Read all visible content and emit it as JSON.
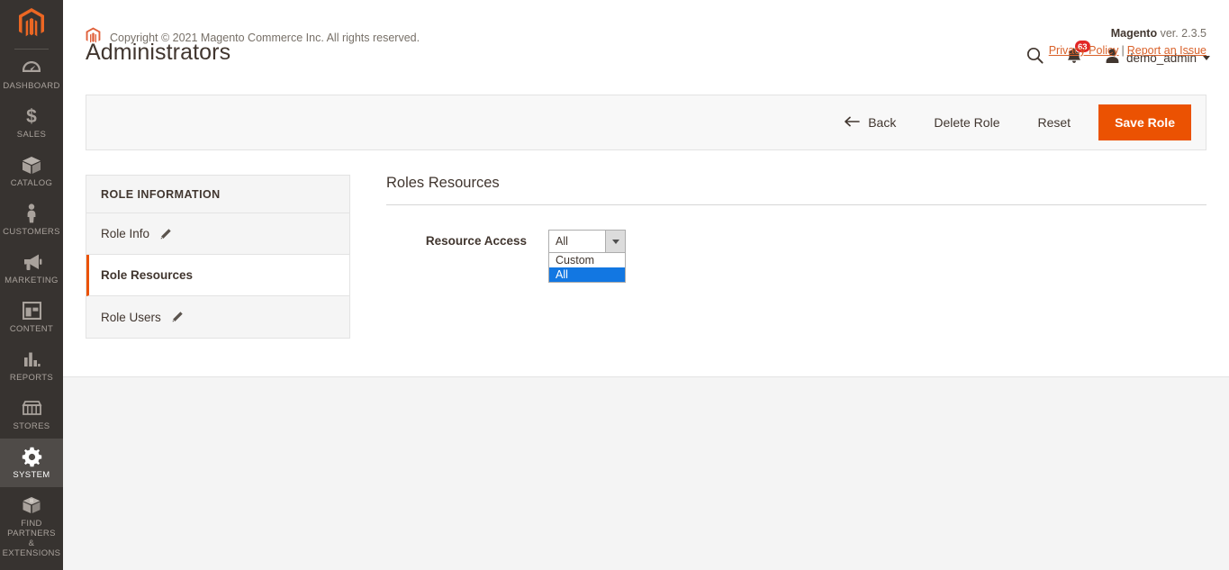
{
  "sidebar": {
    "logo_icon": "magento-logo-icon",
    "items": [
      {
        "label": "DASHBOARD",
        "icon": "dashboard-icon",
        "active": false
      },
      {
        "label": "SALES",
        "icon": "dollar-icon",
        "active": false
      },
      {
        "label": "CATALOG",
        "icon": "box-icon",
        "active": false
      },
      {
        "label": "CUSTOMERS",
        "icon": "person-icon",
        "active": false
      },
      {
        "label": "MARKETING",
        "icon": "megaphone-icon",
        "active": false
      },
      {
        "label": "CONTENT",
        "icon": "layout-icon",
        "active": false
      },
      {
        "label": "REPORTS",
        "icon": "bar-chart-icon",
        "active": false
      },
      {
        "label": "STORES",
        "icon": "storefront-icon",
        "active": false
      },
      {
        "label": "SYSTEM",
        "icon": "gear-icon",
        "active": true
      },
      {
        "label": "FIND PARTNERS\n& EXTENSIONS",
        "label_line1": "FIND PARTNERS",
        "label_line2": "& EXTENSIONS",
        "icon": "package-icon",
        "active": false
      }
    ]
  },
  "header": {
    "title": "Administrators",
    "search_icon": "search-icon",
    "notifications_icon": "bell-icon",
    "notifications_count": "63",
    "user_icon": "user-avatar-icon",
    "user_name": "demo_admin",
    "user_caret_icon": "chevron-down-icon"
  },
  "action_bar": {
    "back_icon": "arrow-left-icon",
    "back_label": "Back",
    "delete_label": "Delete Role",
    "reset_label": "Reset",
    "save_label": "Save Role"
  },
  "tabs_panel": {
    "heading": "ROLE INFORMATION",
    "items": [
      {
        "label": "Role Info",
        "icon": "pencil-icon",
        "has_icon": true,
        "active": false
      },
      {
        "label": "Role Resources",
        "has_icon": false,
        "active": true
      },
      {
        "label": "Role Users",
        "icon": "pencil-icon",
        "has_icon": true,
        "active": false
      }
    ]
  },
  "resources": {
    "section_title": "Roles Resources",
    "field_label": "Resource Access",
    "select_value": "All",
    "select_caret_icon": "chevron-down-icon",
    "options": [
      {
        "label": "Custom",
        "selected": false
      },
      {
        "label": "All",
        "selected": true
      }
    ]
  },
  "footer": {
    "logo_icon": "magento-logo-icon",
    "copyright": "Copyright © 2021 Magento Commerce Inc. All rights reserved.",
    "brand": "Magento",
    "version": " ver. 2.3.5",
    "privacy_link": "Privacy Policy",
    "separator": "|",
    "report_link": "Report an Issue"
  },
  "colors": {
    "accent_orange": "#eb5202",
    "sidebar_bg": "#373330",
    "select_highlight": "#1277e2",
    "badge_red": "#e22626",
    "link_orange": "#d9622b"
  }
}
